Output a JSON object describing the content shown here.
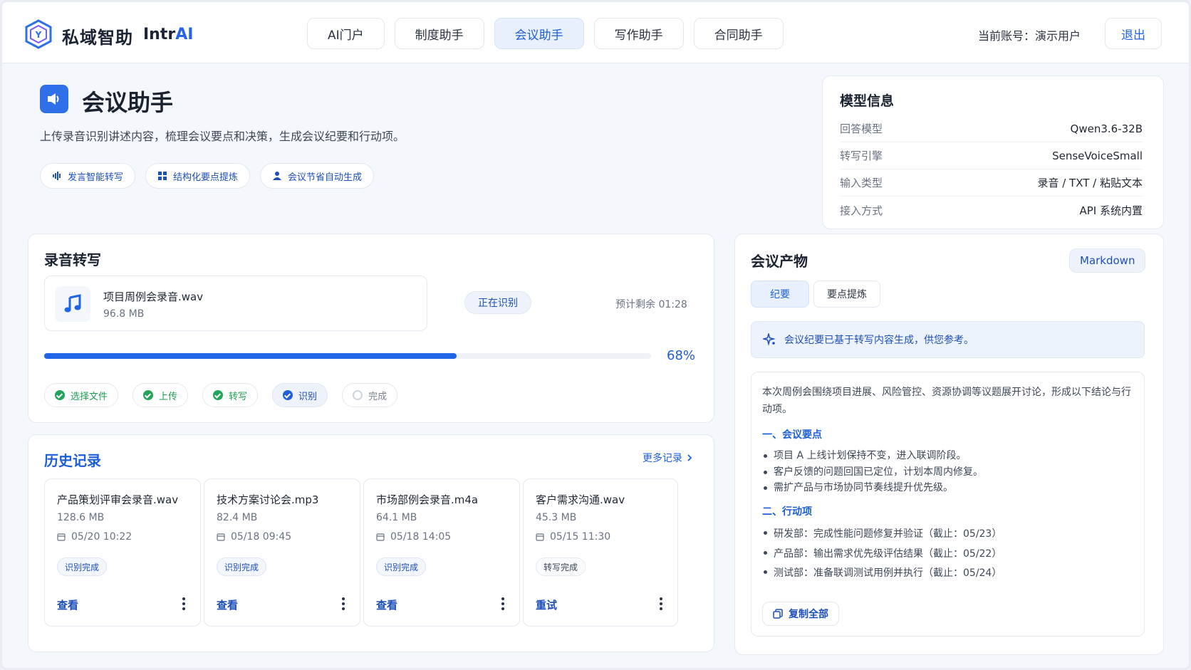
{
  "app": {
    "brand": "私域智助",
    "brand_en_prefix": "Intr",
    "brand_en_suffix": "AI"
  },
  "nav": {
    "tabs": [
      {
        "label": "AI门户"
      },
      {
        "label": "制度助手"
      },
      {
        "label": "会议助手"
      },
      {
        "label": "写作助手"
      },
      {
        "label": "合同助手"
      }
    ],
    "active_tab": "会议助手"
  },
  "account": {
    "label": "当前账号：演示用户",
    "logout": "退出"
  },
  "page": {
    "title": "会议助手",
    "subtitle": "上传录音识别讲述内容，梳理会议要点和决策，生成会议纪要和行动项。",
    "features": [
      {
        "label": "发言智能转写",
        "icon": "waveform-icon"
      },
      {
        "label": "结构化要点提炼",
        "icon": "grid-icon"
      },
      {
        "label": "会议节省自动生成",
        "icon": "user-icon"
      }
    ]
  },
  "model_info": {
    "title": "模型信息",
    "rows": [
      {
        "key": "回答模型",
        "value": "Qwen3.6-32B"
      },
      {
        "key": "转写引擎",
        "value": "SenseVoiceSmall"
      },
      {
        "key": "输入类型",
        "value": "录音 / TXT / 粘贴文本"
      },
      {
        "key": "接入方式",
        "value": "API 系统内置"
      }
    ]
  },
  "recording": {
    "title": "录音转写",
    "file_name": "项目周例会录音.wav",
    "file_size": "96.8 MB",
    "status": "正在识别",
    "eta": "预计剩余 01:28",
    "progress_fraction": 0.68,
    "progress_label": "68%",
    "steps": [
      {
        "label": "选择文件",
        "state": "done"
      },
      {
        "label": "上传",
        "state": "done"
      },
      {
        "label": "转写",
        "state": "done"
      },
      {
        "label": "识别",
        "state": "current"
      },
      {
        "label": "完成",
        "state": "pending"
      }
    ]
  },
  "history": {
    "title": "历史记录",
    "more": "更多记录",
    "items": [
      {
        "name": "产品策划评审会录音.wav",
        "size": "128.6 MB",
        "date": "05/20 10:22",
        "badge": "识别完成",
        "action": "查看"
      },
      {
        "name": "技术方案讨论会.mp3",
        "size": "82.4 MB",
        "date": "05/18 09:45",
        "badge": "识别完成",
        "action": "查看"
      },
      {
        "name": "市场部例会录音.m4a",
        "size": "64.1 MB",
        "date": "05/18 14:05",
        "badge": "识别完成",
        "action": "查看"
      },
      {
        "name": "客户需求沟通.wav",
        "size": "45.3 MB",
        "date": "05/15 11:30",
        "badge": "转写完成",
        "action": "重试"
      }
    ]
  },
  "output": {
    "title": "会议产物",
    "format_button": "Markdown",
    "tabs": [
      {
        "label": "纪要"
      },
      {
        "label": "要点提炼"
      }
    ],
    "notice": "会议纪要已基于转写内容生成，供您参考。",
    "intro": "本次周例会围绕项目进展、风险管控、资源协调等议题展开讨论，形成以下结论与行动项。",
    "section1_title": "一、会议要点",
    "section1_items": [
      "项目 A 上线计划保持不变，进入联调阶段。",
      "客户反馈的问题回国已定位，计划本周内修复。",
      "需扩产品与市场协同节奏线提升优先级。"
    ],
    "section2_title": "二、行动项",
    "section2_items": [
      "研发部：完成性能问题修复并验证（截止：05/23）",
      "产品部：输出需求优先级评估结果（截止：05/22）",
      "测试部：准备联调测试用例并执行（截止：05/24）"
    ],
    "copy_button": "复制全部"
  },
  "colors": {
    "accent": "#1f66e6",
    "success": "#22a55a",
    "page_bg": "#f4f7fb"
  }
}
